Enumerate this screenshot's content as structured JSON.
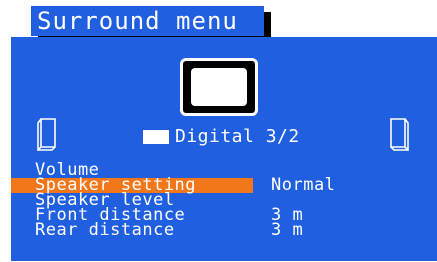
{
  "title": "Surround menu",
  "mode": {
    "label": "Digital 3/2"
  },
  "menu": {
    "items": [
      {
        "label": "Volume",
        "value": "",
        "selected": false
      },
      {
        "label": "Speaker setting",
        "value": "Normal",
        "selected": true
      },
      {
        "label": "Speaker level",
        "value": "",
        "selected": false
      },
      {
        "label": "Front distance",
        "value": "3 m",
        "selected": false
      },
      {
        "label": "Rear distance",
        "value": "3 m",
        "selected": false
      }
    ]
  },
  "colors": {
    "panel": "#1f5fe0",
    "highlight": "#f2761a",
    "text": "#ffffff"
  },
  "icons": [
    "tv-icon",
    "left-speaker-icon",
    "right-speaker-icon",
    "digital-mode-icon"
  ]
}
